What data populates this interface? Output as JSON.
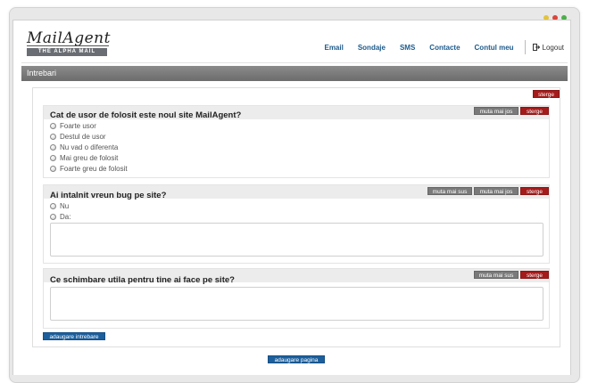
{
  "header": {
    "logo_text": "MailAgent",
    "logo_tagline": "THE ALPHA MAIL",
    "nav": [
      "Email",
      "Sondaje",
      "SMS",
      "Contacte",
      "Contul meu"
    ],
    "logout": "Logout"
  },
  "page": {
    "title": "Intrebari"
  },
  "buttons": {
    "delete": "sterge",
    "move_down": "muta mai jos",
    "move_up": "muta mai sus",
    "add_question": "adaugare intrebare",
    "add_page": "adaugare pagina"
  },
  "questions": [
    {
      "title": "Cat de usor de folosit este noul site MailAgent?",
      "options": [
        "Foarte usor",
        "Destul de usor",
        "Nu vad o diferenta",
        "Mai greu de folosit",
        "Foarte greu de folosit"
      ]
    },
    {
      "title": "Ai intalnit vreun bug pe site?",
      "options": [
        "Nu",
        "Da:"
      ]
    },
    {
      "title": "Ce schimbare utila pentru tine ai face pe site?",
      "options": []
    }
  ],
  "colors": {
    "nav_link": "#1d5a8a",
    "delete_button": "#a51b1b",
    "move_button": "#7a7a7a",
    "add_button": "#1c5f9c",
    "title_bar": "#7a7a7a"
  },
  "window_dots": [
    "#e2c33c",
    "#d9463a",
    "#4cae4a"
  ]
}
